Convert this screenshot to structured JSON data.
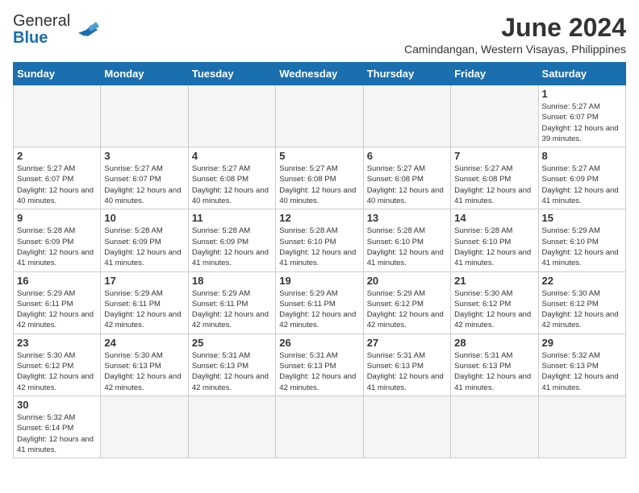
{
  "header": {
    "title": "June 2024",
    "subtitle": "Camindangan, Western Visayas, Philippines",
    "logo_general": "General",
    "logo_blue": "Blue"
  },
  "days_of_week": [
    "Sunday",
    "Monday",
    "Tuesday",
    "Wednesday",
    "Thursday",
    "Friday",
    "Saturday"
  ],
  "weeks": [
    [
      {
        "day": "",
        "info": ""
      },
      {
        "day": "",
        "info": ""
      },
      {
        "day": "",
        "info": ""
      },
      {
        "day": "",
        "info": ""
      },
      {
        "day": "",
        "info": ""
      },
      {
        "day": "",
        "info": ""
      },
      {
        "day": "1",
        "info": "Sunrise: 5:27 AM\nSunset: 6:07 PM\nDaylight: 12 hours and 39 minutes."
      }
    ],
    [
      {
        "day": "2",
        "info": "Sunrise: 5:27 AM\nSunset: 6:07 PM\nDaylight: 12 hours and 40 minutes."
      },
      {
        "day": "3",
        "info": "Sunrise: 5:27 AM\nSunset: 6:07 PM\nDaylight: 12 hours and 40 minutes."
      },
      {
        "day": "4",
        "info": "Sunrise: 5:27 AM\nSunset: 6:08 PM\nDaylight: 12 hours and 40 minutes."
      },
      {
        "day": "5",
        "info": "Sunrise: 5:27 AM\nSunset: 6:08 PM\nDaylight: 12 hours and 40 minutes."
      },
      {
        "day": "6",
        "info": "Sunrise: 5:27 AM\nSunset: 6:08 PM\nDaylight: 12 hours and 40 minutes."
      },
      {
        "day": "7",
        "info": "Sunrise: 5:27 AM\nSunset: 6:08 PM\nDaylight: 12 hours and 41 minutes."
      },
      {
        "day": "8",
        "info": "Sunrise: 5:27 AM\nSunset: 6:09 PM\nDaylight: 12 hours and 41 minutes."
      }
    ],
    [
      {
        "day": "9",
        "info": "Sunrise: 5:28 AM\nSunset: 6:09 PM\nDaylight: 12 hours and 41 minutes."
      },
      {
        "day": "10",
        "info": "Sunrise: 5:28 AM\nSunset: 6:09 PM\nDaylight: 12 hours and 41 minutes."
      },
      {
        "day": "11",
        "info": "Sunrise: 5:28 AM\nSunset: 6:09 PM\nDaylight: 12 hours and 41 minutes."
      },
      {
        "day": "12",
        "info": "Sunrise: 5:28 AM\nSunset: 6:10 PM\nDaylight: 12 hours and 41 minutes."
      },
      {
        "day": "13",
        "info": "Sunrise: 5:28 AM\nSunset: 6:10 PM\nDaylight: 12 hours and 41 minutes."
      },
      {
        "day": "14",
        "info": "Sunrise: 5:28 AM\nSunset: 6:10 PM\nDaylight: 12 hours and 41 minutes."
      },
      {
        "day": "15",
        "info": "Sunrise: 5:29 AM\nSunset: 6:10 PM\nDaylight: 12 hours and 41 minutes."
      }
    ],
    [
      {
        "day": "16",
        "info": "Sunrise: 5:29 AM\nSunset: 6:11 PM\nDaylight: 12 hours and 42 minutes."
      },
      {
        "day": "17",
        "info": "Sunrise: 5:29 AM\nSunset: 6:11 PM\nDaylight: 12 hours and 42 minutes."
      },
      {
        "day": "18",
        "info": "Sunrise: 5:29 AM\nSunset: 6:11 PM\nDaylight: 12 hours and 42 minutes."
      },
      {
        "day": "19",
        "info": "Sunrise: 5:29 AM\nSunset: 6:11 PM\nDaylight: 12 hours and 42 minutes."
      },
      {
        "day": "20",
        "info": "Sunrise: 5:29 AM\nSunset: 6:12 PM\nDaylight: 12 hours and 42 minutes."
      },
      {
        "day": "21",
        "info": "Sunrise: 5:30 AM\nSunset: 6:12 PM\nDaylight: 12 hours and 42 minutes."
      },
      {
        "day": "22",
        "info": "Sunrise: 5:30 AM\nSunset: 6:12 PM\nDaylight: 12 hours and 42 minutes."
      }
    ],
    [
      {
        "day": "23",
        "info": "Sunrise: 5:30 AM\nSunset: 6:12 PM\nDaylight: 12 hours and 42 minutes."
      },
      {
        "day": "24",
        "info": "Sunrise: 5:30 AM\nSunset: 6:13 PM\nDaylight: 12 hours and 42 minutes."
      },
      {
        "day": "25",
        "info": "Sunrise: 5:31 AM\nSunset: 6:13 PM\nDaylight: 12 hours and 42 minutes."
      },
      {
        "day": "26",
        "info": "Sunrise: 5:31 AM\nSunset: 6:13 PM\nDaylight: 12 hours and 42 minutes."
      },
      {
        "day": "27",
        "info": "Sunrise: 5:31 AM\nSunset: 6:13 PM\nDaylight: 12 hours and 41 minutes."
      },
      {
        "day": "28",
        "info": "Sunrise: 5:31 AM\nSunset: 6:13 PM\nDaylight: 12 hours and 41 minutes."
      },
      {
        "day": "29",
        "info": "Sunrise: 5:32 AM\nSunset: 6:13 PM\nDaylight: 12 hours and 41 minutes."
      }
    ],
    [
      {
        "day": "30",
        "info": "Sunrise: 5:32 AM\nSunset: 6:14 PM\nDaylight: 12 hours and 41 minutes."
      },
      {
        "day": "",
        "info": ""
      },
      {
        "day": "",
        "info": ""
      },
      {
        "day": "",
        "info": ""
      },
      {
        "day": "",
        "info": ""
      },
      {
        "day": "",
        "info": ""
      },
      {
        "day": "",
        "info": ""
      }
    ]
  ]
}
